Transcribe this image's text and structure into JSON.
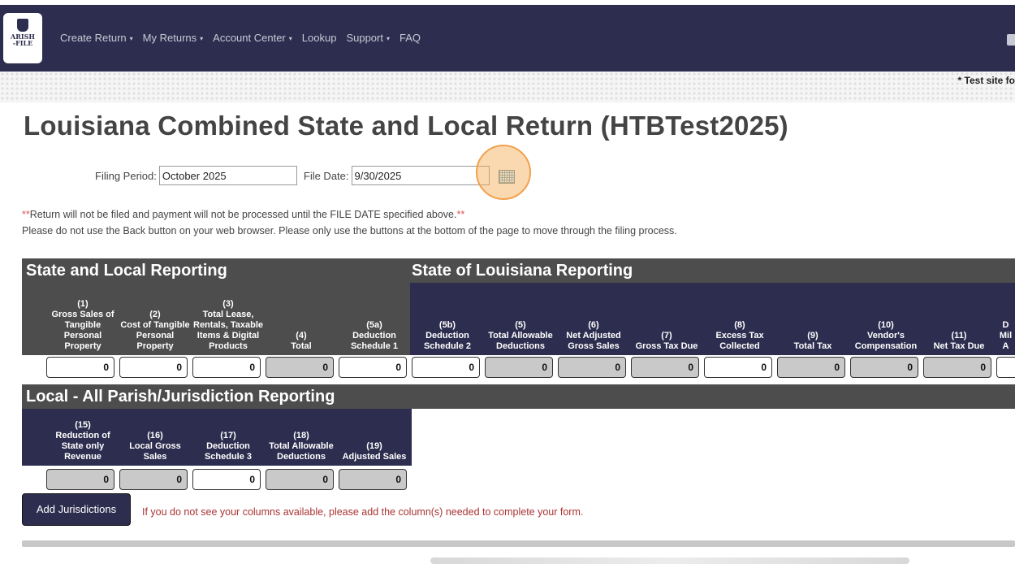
{
  "navbar": {
    "logo_line1": "ARISH",
    "logo_line2": "-FILE",
    "items": [
      "Create Return",
      "My Returns",
      "Account Center",
      "Lookup",
      "Support",
      "FAQ"
    ],
    "dropdown_items": [
      true,
      true,
      true,
      false,
      true,
      false
    ]
  },
  "banner": {
    "test_site": "* Test site fo"
  },
  "page": {
    "title": "Louisiana Combined State and Local Return (HTBTest2025)"
  },
  "filing": {
    "period_label": "Filing Period:",
    "period_value": "October 2025",
    "date_label": "File Date:",
    "date_value": "9/30/2025"
  },
  "notes": {
    "red_prefix": "**",
    "filing_notice": "Return will not be filed and payment will not be processed until the FILE DATE specified above.",
    "red_suffix": "**",
    "back_button_notice": "Please do not use the Back button on your web browser. Please only use the buttons at the bottom of the page to move through the filing process."
  },
  "sections": {
    "state_local": "State and Local Reporting",
    "state_la": "State of Louisiana Reporting",
    "local_all": "Local - All Parish/Jurisdiction Reporting"
  },
  "state_columns": [
    {
      "label": "(1)\nGross Sales of\nTangible\nPersonal\nProperty",
      "value": "0",
      "editable": true
    },
    {
      "label": "(2)\nCost of Tangible\nPersonal\nProperty",
      "value": "0",
      "editable": true
    },
    {
      "label": "(3)\nTotal Lease,\nRentals, Taxable\nItems & Digital\nProducts",
      "value": "0",
      "editable": true
    },
    {
      "label": "(4)\nTotal",
      "value": "0",
      "editable": false
    },
    {
      "label": "(5a)\nDeduction\nSchedule 1",
      "value": "0",
      "editable": true
    },
    {
      "label": "(5b)\nDeduction\nSchedule 2",
      "value": "0",
      "editable": true
    },
    {
      "label": "(5)\nTotal Allowable\nDeductions",
      "value": "0",
      "editable": false
    },
    {
      "label": "(6)\nNet Adjusted\nGross Sales",
      "value": "0",
      "editable": false
    },
    {
      "label": "(7)\nGross Tax Due",
      "value": "0",
      "editable": false
    },
    {
      "label": "(8)\nExcess Tax\nCollected",
      "value": "0",
      "editable": true
    },
    {
      "label": "(9)\nTotal Tax",
      "value": "0",
      "editable": false
    },
    {
      "label": "(10)\nVendor's\nCompensation",
      "value": "0",
      "editable": false
    },
    {
      "label": "(11)\nNet Tax Due",
      "value": "0",
      "editable": false
    },
    {
      "label": "D\nMil\nA",
      "value": "",
      "editable": true
    }
  ],
  "local_columns": [
    {
      "label": "(15)\nReduction of\nState only\nRevenue",
      "value": "0",
      "editable": false
    },
    {
      "label": "(16)\nLocal Gross\nSales",
      "value": "0",
      "editable": false
    },
    {
      "label": "(17)\nDeduction\nSchedule 3",
      "value": "0",
      "editable": true
    },
    {
      "label": "(18)\nTotal Allowable\nDeductions",
      "value": "0",
      "editable": false
    },
    {
      "label": "(19)\nAdjusted Sales",
      "value": "0",
      "editable": false
    }
  ],
  "actions": {
    "add_jurisdictions": "Add Jurisdictions",
    "add_note": "If you do not see your columns available, please add the column(s) needed to complete your form."
  },
  "colors": {
    "navbar": "#2d2d4f",
    "section": "#4d4d4d",
    "readonly_cell": "#c9c9c9",
    "highlight": "#f2a04d"
  }
}
